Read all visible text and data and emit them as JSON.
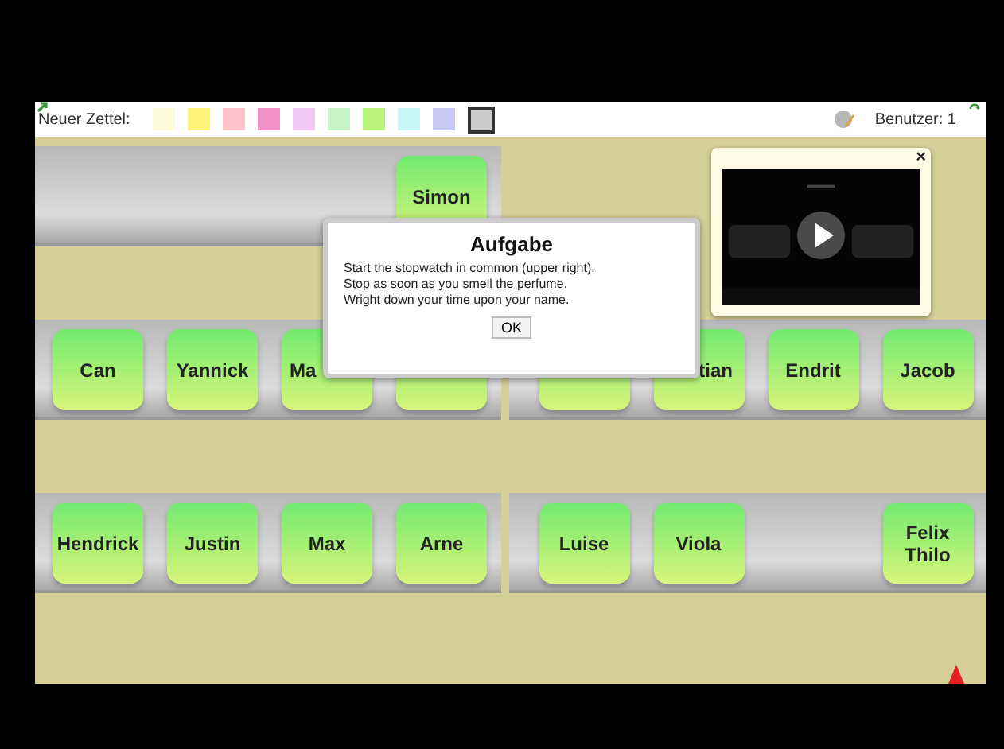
{
  "toolbar": {
    "label": "Neuer Zettel:",
    "swatches": [
      {
        "color": "#fffbd8",
        "selected": false
      },
      {
        "color": "#fff27a",
        "selected": false
      },
      {
        "color": "#ffc4c9",
        "selected": false
      },
      {
        "color": "#f28fc4",
        "selected": false
      },
      {
        "color": "#f4c8f4",
        "selected": false
      },
      {
        "color": "#c8f5c8",
        "selected": false
      },
      {
        "color": "#b7f27c",
        "selected": false
      },
      {
        "color": "#c8f5f5",
        "selected": false
      },
      {
        "color": "#c8c8f5",
        "selected": false
      },
      {
        "color": "#cccccc",
        "selected": true
      }
    ],
    "users": "Benutzer: 1"
  },
  "shelves": [
    {
      "halves": [
        {
          "shelf": true,
          "slots": [
            {
              "kind": "gap"
            },
            {
              "kind": "gap"
            },
            {
              "kind": "gap"
            },
            {
              "kind": "card",
              "label": "Simon"
            }
          ]
        },
        {
          "shelf": false
        }
      ]
    },
    {
      "halves": [
        {
          "shelf": true,
          "slots": [
            {
              "kind": "card",
              "label": "Can"
            },
            {
              "kind": "card",
              "label": "Yannick"
            },
            {
              "kind": "tail",
              "label": "Ma"
            },
            {
              "kind": "card"
            }
          ]
        },
        {
          "shelf": true,
          "slots": [
            {
              "kind": "card"
            },
            {
              "kind": "head",
              "label": "tian"
            },
            {
              "kind": "card",
              "label": "Endrit"
            },
            {
              "kind": "card",
              "label": "Jacob"
            }
          ]
        }
      ]
    },
    {
      "halves": [
        {
          "shelf": true,
          "slots": [
            {
              "kind": "card",
              "label": "Hendrick"
            },
            {
              "kind": "card",
              "label": "Justin"
            },
            {
              "kind": "card",
              "label": "Max"
            },
            {
              "kind": "card",
              "label": "Arne"
            }
          ]
        },
        {
          "shelf": true,
          "slots": [
            {
              "kind": "card",
              "label": "Luise"
            },
            {
              "kind": "card",
              "label": "Viola"
            },
            {
              "kind": "gap"
            },
            {
              "kind": "card",
              "label": "Felix Thilo"
            }
          ]
        }
      ]
    }
  ],
  "stopwatch": {
    "kind": "picture",
    "close": "×"
  },
  "dialog": {
    "title": "Aufgabe",
    "lines": [
      "Start the stopwatch in common (upper right).",
      "Stop as soon as you smell the perfume.",
      "Wright down your time upon your name."
    ],
    "button": "OK"
  }
}
